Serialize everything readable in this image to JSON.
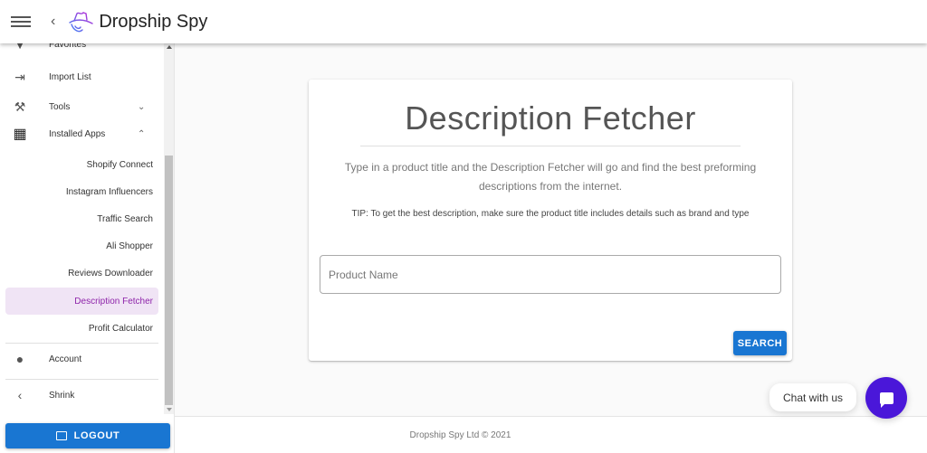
{
  "header": {
    "brand": "Dropship Spy",
    "menu_icon": "hamburger-icon",
    "back_icon": "chevron-left-icon",
    "logo_icon": "hat-logo-icon"
  },
  "sidebar": {
    "items": [
      {
        "label": "Favorites",
        "icon": "heart-icon"
      },
      {
        "label": "Import List",
        "icon": "import-icon"
      },
      {
        "label": "Tools",
        "icon": "tools-icon",
        "chevron": "chevron-down"
      },
      {
        "label": "Installed Apps",
        "icon": "apps-grid-icon",
        "chevron": "chevron-up"
      }
    ],
    "sub_items": [
      {
        "label": "Shopify Connect",
        "active": false
      },
      {
        "label": "Instagram Influencers",
        "active": false
      },
      {
        "label": "Traffic Search",
        "active": false
      },
      {
        "label": "Ali Shopper",
        "active": false
      },
      {
        "label": "Reviews Downloader",
        "active": false
      },
      {
        "label": "Description Fetcher",
        "active": true
      },
      {
        "label": "Profit Calculator",
        "active": false
      }
    ],
    "account": {
      "label": "Account",
      "icon": "person-icon"
    },
    "shrink": {
      "label": "Shrink",
      "icon": "chevron-left-icon"
    },
    "logout": {
      "label": "LOGOUT",
      "icon": "logout-icon"
    }
  },
  "card": {
    "title": "Description Fetcher",
    "description": "Type in a product title and the Description Fetcher will go and find the best preforming descriptions from the internet.",
    "tip": "TIP: To get the best description, make sure the product title includes details such as brand and type",
    "input": {
      "placeholder": "Product Name",
      "value": ""
    },
    "search_label": "SEARCH"
  },
  "footer": {
    "text": "Dropship Spy Ltd © 2021"
  },
  "chat": {
    "label": "Chat with us"
  },
  "colors": {
    "primary": "#1976d2",
    "active_bg": "#f0e4f5",
    "active_text": "#8e24aa",
    "chat": "#4a17d9"
  }
}
